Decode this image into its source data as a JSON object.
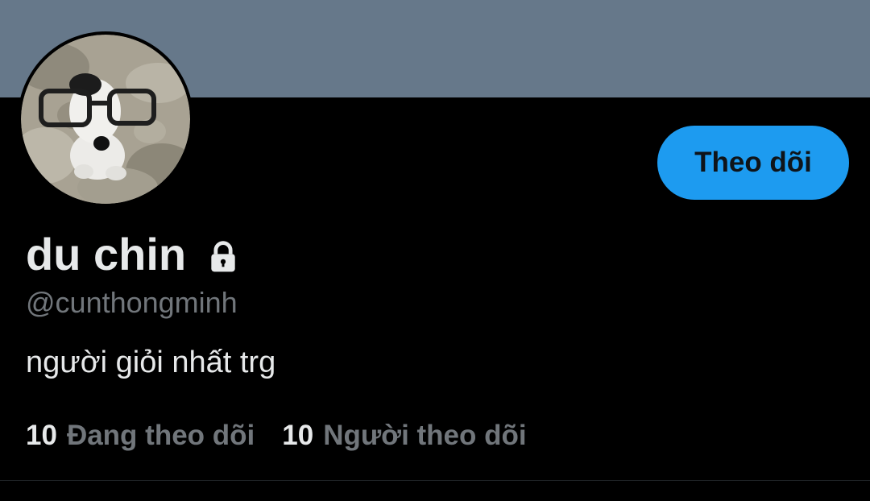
{
  "profile": {
    "display_name": "du chin",
    "handle": "@cunthongminh",
    "bio": "người giỏi nhất trg",
    "protected_icon": "lock-icon",
    "avatar_icon": "avatar-photo"
  },
  "actions": {
    "follow_label": "Theo dõi"
  },
  "stats": {
    "following_count": "10",
    "following_label": "Đang theo dõi",
    "followers_count": "10",
    "followers_label": "Người theo dõi"
  },
  "colors": {
    "banner": "#66788a",
    "background": "#000000",
    "accent": "#1d9bf0",
    "primary_text": "#e7e9ea",
    "secondary_text": "#71767b"
  }
}
